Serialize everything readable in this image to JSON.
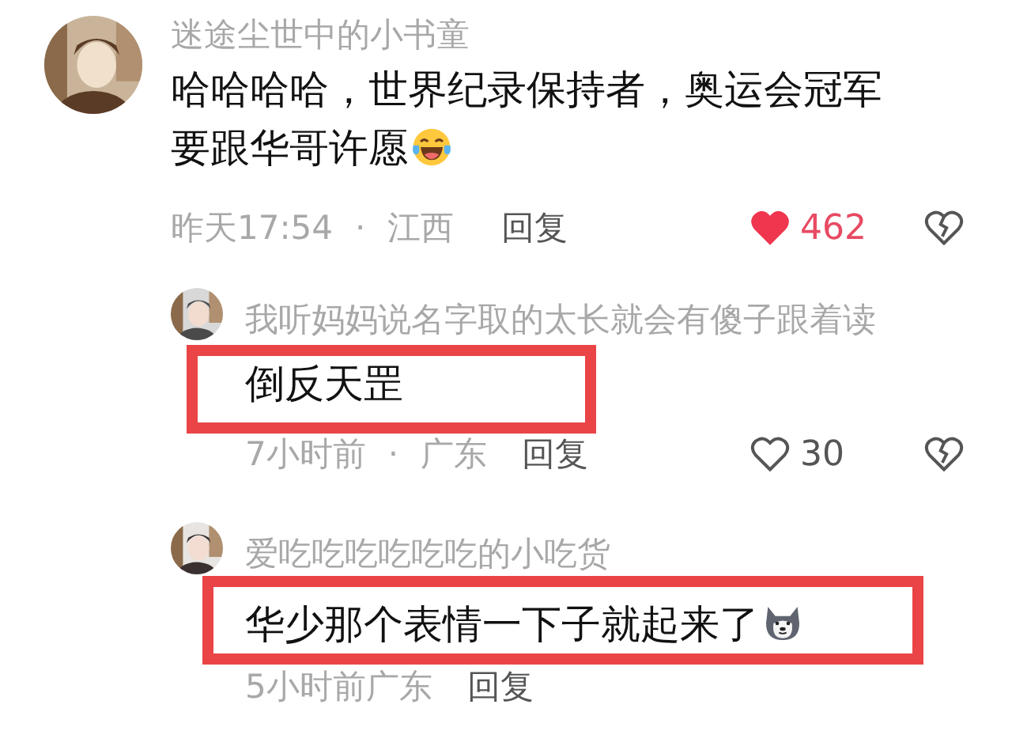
{
  "comments": [
    {
      "user": "迷途尘世中的小书童",
      "text": "哈哈哈哈，世界纪录保持者，奥运会冠军要跟华哥许愿",
      "emoji": {
        "kind": "laugh-cry"
      },
      "time": "昨天17:54",
      "separator": "·",
      "region": "江西",
      "reply_label": "回复",
      "likes": "462",
      "liked": true,
      "replies": [
        {
          "user": "我听妈妈说名字取的太长就会有傻子跟着读",
          "text": "倒反天罡",
          "time": "7小时前",
          "separator": "·",
          "region": "广东",
          "reply_label": "回复",
          "likes": "30",
          "liked": false,
          "highlighted": true
        },
        {
          "user": "爱吃吃吃吃吃吃的小吃货",
          "text": "华少那个表情一下子就起来了",
          "emoji": {
            "kind": "dog"
          },
          "time": "5小时前",
          "region": "广东",
          "reply_label": "回复",
          "highlighted": true
        }
      ]
    }
  ]
}
